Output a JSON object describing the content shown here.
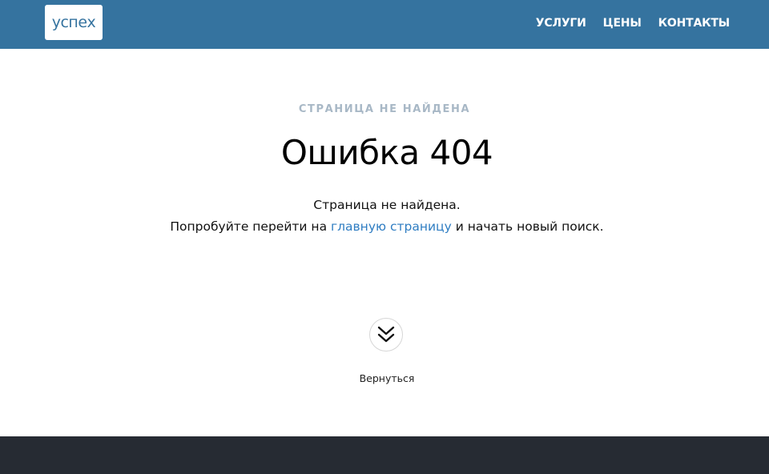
{
  "header": {
    "logo_text": "успех",
    "nav": [
      "УСЛУГИ",
      "ЦЕНЫ",
      "КОНТАКТЫ"
    ]
  },
  "main": {
    "eyebrow": "СТРАНИЦА НЕ НАЙДЕНА",
    "title": "Ошибка 404",
    "line1": "Страница не найдена.",
    "line2_before": "Попробуйте перейти на ",
    "line2_link": "главную страницу",
    "line2_after": " и начать новый поиск.",
    "back_icon": "chevron-double-down-icon",
    "back_label": "Вернуться"
  },
  "colors": {
    "header_bg": "#35739f",
    "footer_bg": "#262b33",
    "link": "#2f7dc2",
    "eyebrow": "#a8b8c6"
  }
}
